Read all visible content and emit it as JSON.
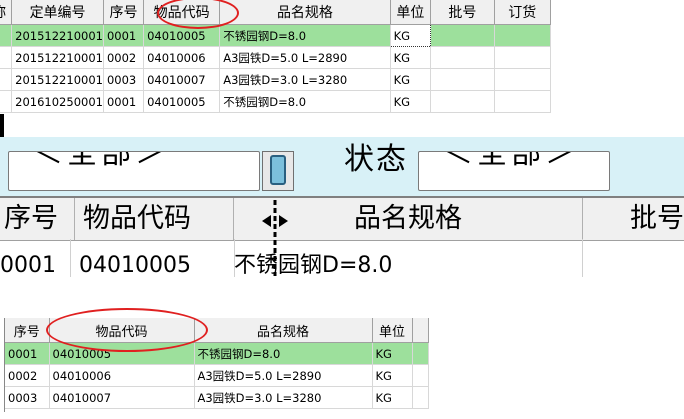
{
  "top_grid": {
    "headers": [
      "称",
      "定单编号",
      "序号",
      "物品代码",
      "品名规格",
      "单位",
      "批号",
      "订货"
    ],
    "rows": [
      [
        "",
        "201512210001",
        "0001",
        "04010005",
        "不锈园钢D=8.0",
        "KG",
        "",
        ""
      ],
      [
        "",
        "201512210001",
        "0002",
        "04010006",
        "A3园铁D=5.0 L=2890",
        "KG",
        "",
        ""
      ],
      [
        "",
        "201512210001",
        "0003",
        "04010007",
        "A3园铁D=3.0 L=3280",
        "KG",
        "",
        ""
      ],
      [
        "",
        "201610250001",
        "0001",
        "04010005",
        "不锈园钢D=8.0",
        "KG",
        "",
        ""
      ]
    ]
  },
  "zoom_panel": {
    "combo1_text": "＜全部＞",
    "state_label": "状态",
    "combo2_text": "＜全部＞",
    "headers": [
      "序号",
      "物品代码",
      "品名规格",
      "批号"
    ],
    "row": [
      "0001",
      "04010005",
      "不锈园钢D=8.0",
      ""
    ]
  },
  "bottom_grid": {
    "headers": [
      "序号",
      "物品代码",
      "品名规格",
      "单位",
      ""
    ],
    "rows": [
      [
        "0001",
        "04010005",
        "不锈园钢D=8.0",
        "KG",
        ""
      ],
      [
        "0002",
        "04010006",
        "A3园铁D=5.0 L=2890",
        "KG",
        ""
      ],
      [
        "0003",
        "04010007",
        "A3园铁D=3.0 L=3280",
        "KG",
        ""
      ]
    ]
  },
  "colors": {
    "selected_row": "#9de09c",
    "annotation_ring": "#e02020",
    "filter_bar": "#d8f1f7"
  }
}
